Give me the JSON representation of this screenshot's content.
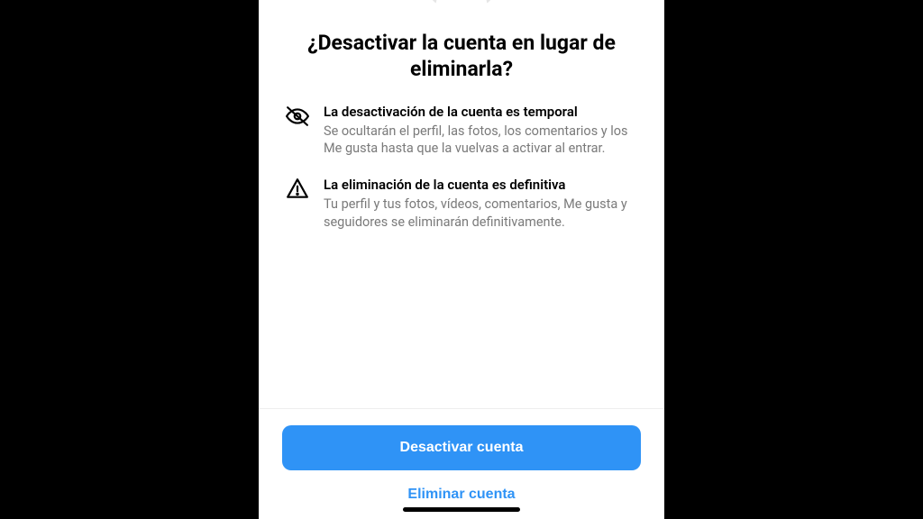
{
  "title": "¿Desactivar la cuenta en lugar de eliminarla?",
  "items": [
    {
      "title": "La desactivación de la cuenta es temporal",
      "desc": "Se ocultarán el perfil, las fotos, los comentarios y los Me gusta hasta que la vuelvas a activar al entrar."
    },
    {
      "title": "La eliminación de la cuenta es definitiva",
      "desc": "Tu perfil y tus fotos, vídeos, comentarios, Me gusta y seguidores se eliminarán definitivamente."
    }
  ],
  "buttons": {
    "deactivate": "Desactivar cuenta",
    "delete": "Eliminar cuenta"
  }
}
